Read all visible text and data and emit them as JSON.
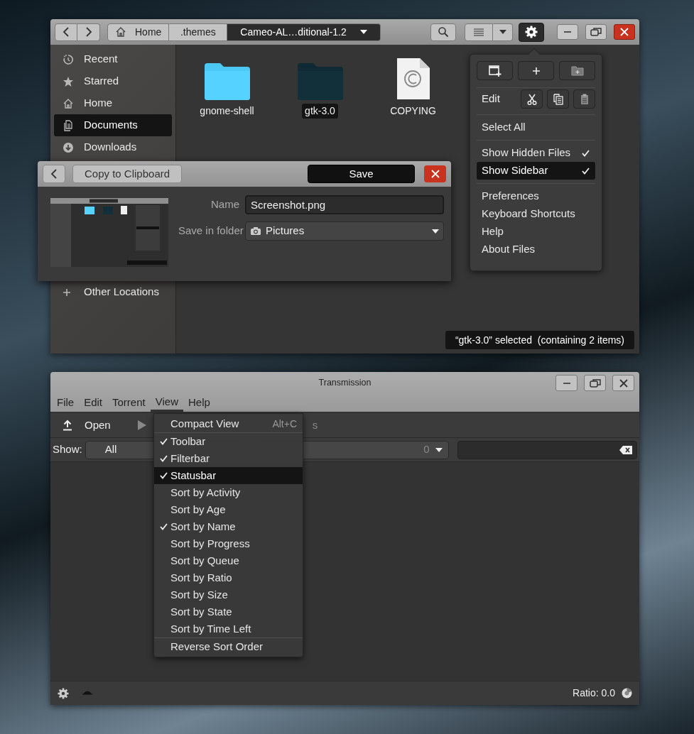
{
  "files_window": {
    "path_bar": [
      {
        "label": "Home",
        "kind": "home",
        "selected": false
      },
      {
        "label": ".themes",
        "kind": "plain",
        "selected": false
      },
      {
        "label": "Cameo-AL…ditional-1.2",
        "kind": "plain",
        "selected": true
      }
    ],
    "settings_menu_open": true,
    "sidebar": [
      {
        "label": "Recent",
        "selected": false
      },
      {
        "label": "Starred",
        "selected": false
      },
      {
        "label": "Home",
        "selected": false
      },
      {
        "label": "Documents",
        "selected": true
      },
      {
        "label": "Downloads",
        "selected": false
      },
      {
        "label": "Other Locations",
        "selected": false
      }
    ],
    "files": [
      {
        "name": "gnome-shell",
        "kind": "folder-light",
        "selected": false
      },
      {
        "name": "gtk-3.0",
        "kind": "folder-dark",
        "selected": true
      },
      {
        "name": "COPYING",
        "kind": "document",
        "selected": false
      }
    ],
    "status": "“gtk-3.0” selected  (containing 2 items)",
    "menu": {
      "edit_label": "Edit",
      "sections": [
        [
          {
            "label": "Select All",
            "checked": false,
            "selected": false
          }
        ],
        [
          {
            "label": "Show Hidden Files",
            "checked": true,
            "selected": false
          },
          {
            "label": "Show Sidebar",
            "checked": true,
            "selected": true
          }
        ],
        [
          {
            "label": "Preferences",
            "checked": false,
            "selected": false
          },
          {
            "label": "Keyboard Shortcuts",
            "checked": false,
            "selected": false
          },
          {
            "label": "Help",
            "checked": false,
            "selected": false
          },
          {
            "label": "About Files",
            "checked": false,
            "selected": false
          }
        ]
      ]
    }
  },
  "screenshot_dialog": {
    "copy_label": "Copy to Clipboard",
    "save_label": "Save",
    "name_label": "Name",
    "name_value": "Screenshot.png",
    "folder_label": "Save in folder",
    "folder_value": "Pictures"
  },
  "transmission": {
    "title": "Transmission",
    "menubar": [
      {
        "label": "File",
        "selected": false
      },
      {
        "label": "Edit",
        "selected": false
      },
      {
        "label": "Torrent",
        "selected": false
      },
      {
        "label": "View",
        "selected": true
      },
      {
        "label": "Help",
        "selected": false
      }
    ],
    "toolbar": {
      "open_label": "Open",
      "partial_label": "s"
    },
    "filterbar": {
      "show_label": "Show:",
      "first_filter": "All",
      "count": "0"
    },
    "view_menu": [
      [
        {
          "label": "Compact View",
          "accel": "Alt+C",
          "checked": false,
          "selected": false
        }
      ],
      [
        {
          "label": "Toolbar",
          "checked": true,
          "selected": false
        },
        {
          "label": "Filterbar",
          "checked": true,
          "selected": false
        },
        {
          "label": "Statusbar",
          "checked": true,
          "selected": true
        },
        {
          "label": "Sort by Activity",
          "checked": false,
          "selected": false
        },
        {
          "label": "Sort by Age",
          "checked": false,
          "selected": false
        },
        {
          "label": "Sort by Name",
          "checked": true,
          "selected": false
        },
        {
          "label": "Sort by Progress",
          "checked": false,
          "selected": false
        },
        {
          "label": "Sort by Queue",
          "checked": false,
          "selected": false
        },
        {
          "label": "Sort by Ratio",
          "checked": false,
          "selected": false
        },
        {
          "label": "Sort by Size",
          "checked": false,
          "selected": false
        },
        {
          "label": "Sort by State",
          "checked": false,
          "selected": false
        },
        {
          "label": "Sort by Time Left",
          "checked": false,
          "selected": false
        }
      ],
      [
        {
          "label": "Reverse Sort Order",
          "checked": false,
          "selected": false
        }
      ]
    ],
    "status": {
      "ratio": "Ratio: 0.0"
    }
  }
}
